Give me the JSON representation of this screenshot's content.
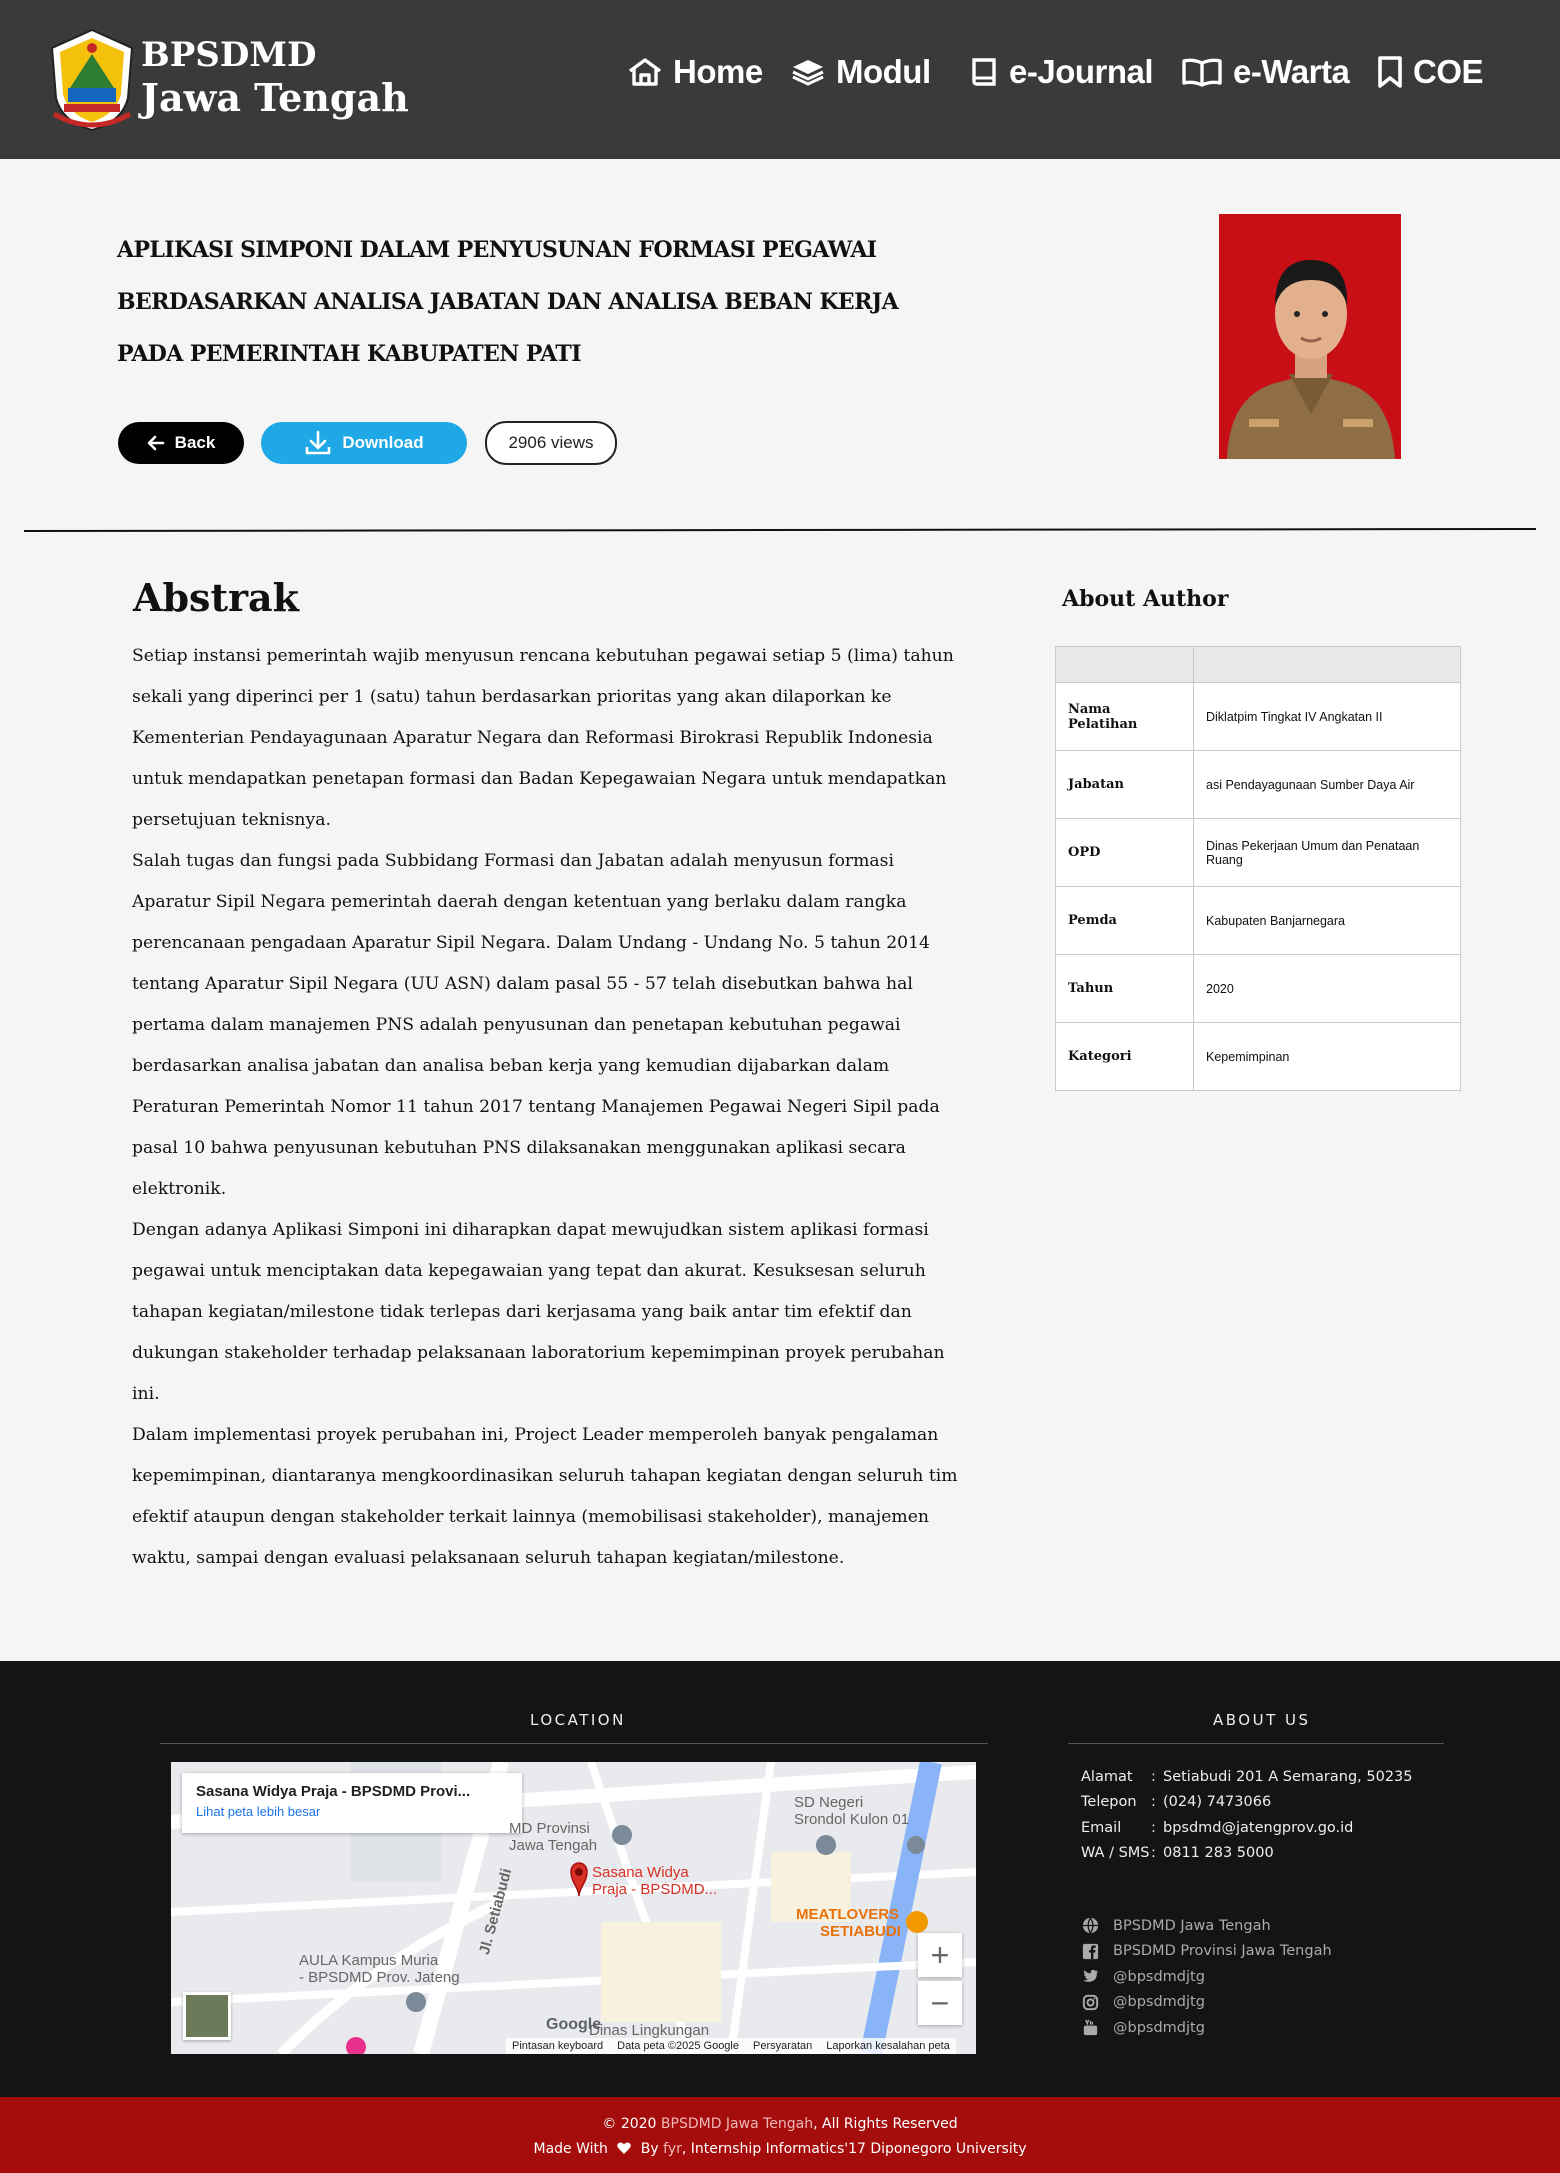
{
  "brand": {
    "line1": "BPSDMD",
    "line2": "Jawa Tengah"
  },
  "nav": [
    {
      "label": "Home",
      "icon": "home-icon"
    },
    {
      "label": "Modul",
      "icon": "layers-icon"
    },
    {
      "label": "e-Journal",
      "icon": "book-icon"
    },
    {
      "label": "e-Warta",
      "icon": "open-book-icon"
    },
    {
      "label": "COE",
      "icon": "bookmark-icon"
    }
  ],
  "article": {
    "title_lines": [
      "APLIKASI SIMPONI DALAM PENYUSUNAN FORMASI PEGAWAI",
      "BERDASARKAN ANALISA JABATAN DAN ANALISA BEBAN KERJA",
      "PADA PEMERINTAH KABUPATEN PATI"
    ],
    "back_label": "Back",
    "download_label": "Download",
    "views_label": "2906 views"
  },
  "abstract": {
    "heading": "Abstrak",
    "paragraphs": [
      "Setiap instansi pemerintah wajib menyusun rencana kebutuhan pegawai setiap 5 (lima) tahun sekali yang diperinci per 1 (satu) tahun berdasarkan prioritas yang akan dilaporkan ke Kementerian Pendayagunaan Aparatur Negara dan Reformasi Birokrasi Republik Indonesia untuk mendapatkan penetapan formasi dan Badan Kepegawaian Negara untuk mendapatkan persetujuan teknisnya.",
      "Salah tugas dan fungsi pada Subbidang Formasi dan Jabatan adalah menyusun formasi Aparatur Sipil Negara pemerintah daerah dengan ketentuan yang berlaku dalam rangka perencanaan pengadaan Aparatur Sipil Negara. Dalam Undang - Undang No. 5 tahun 2014 tentang Aparatur Sipil Negara (UU ASN) dalam pasal 55 - 57 telah disebutkan bahwa hal pertama dalam manajemen PNS adalah penyusunan dan penetapan kebutuhan pegawai berdasarkan analisa jabatan dan analisa beban kerja yang kemudian dijabarkan dalam Peraturan Pemerintah Nomor 11 tahun 2017 tentang Manajemen Pegawai Negeri Sipil pada pasal 10 bahwa penyusunan kebutuhan PNS dilaksanakan menggunakan aplikasi secara elektronik.",
      "Dengan adanya Aplikasi Simponi ini diharapkan dapat mewujudkan sistem aplikasi formasi pegawai untuk menciptakan data kepegawaian yang tepat dan akurat. Kesuksesan seluruh tahapan kegiatan/milestone tidak terlepas dari kerjasama yang baik antar tim efektif dan dukungan stakeholder terhadap pelaksanaan laboratorium kepemimpinan proyek perubahan ini.",
      "Dalam implementasi proyek perubahan ini, Project Leader memperoleh banyak pengalaman kepemimpinan, diantaranya mengkoordinasikan seluruh tahapan kegiatan dengan seluruh tim efektif ataupun dengan stakeholder terkait lainnya (memobilisasi stakeholder), manajemen waktu, sampai dengan evaluasi pelaksanaan seluruh tahapan kegiatan/milestone."
    ]
  },
  "author": {
    "heading": "About Author",
    "rows": [
      {
        "key": "Nama Pelatihan",
        "value": "Diklatpim Tingkat IV Angkatan II"
      },
      {
        "key": "Jabatan",
        "value": "asi Pendayagunaan Sumber Daya Air"
      },
      {
        "key": "OPD",
        "value": "Dinas Pekerjaan Umum dan Penataan Ruang"
      },
      {
        "key": "Pemda",
        "value": "Kabupaten Banjarnegara"
      },
      {
        "key": "Tahun",
        "value": "2020"
      },
      {
        "key": "Kategori",
        "value": "Kepemimpinan"
      }
    ]
  },
  "footer": {
    "location_heading": "LOCATION",
    "about_heading": "ABOUT US",
    "map": {
      "place_title": "Sasana Widya Praja - BPSDMD Provi...",
      "larger_map_link": "Lihat peta lebih besar",
      "labels": [
        "Sasana Widya",
        "Praja - BPSDMD...",
        "SD Negeri",
        "Srondol Kulon 01",
        "MD Provinsi",
        "Jawa Tengah",
        "MEATLOVERS",
        "SETIABUDI",
        "AULA Kampus Muria",
        "- BPSDMD Prov. Jateng",
        "Jl. Setiabudi",
        "Dinas Lingkungan",
        "Google"
      ],
      "footer_links": [
        "Pintasan keyboard",
        "Data peta ©2025 Google",
        "Persyaratan",
        "Laporkan kesalahan peta"
      ],
      "zoom_in": "+",
      "zoom_out": "−"
    },
    "contact": [
      {
        "label": "Alamat",
        "value": "Setiabudi 201 A Semarang, 50235"
      },
      {
        "label": "Telepon",
        "value": "(024) 7473066"
      },
      {
        "label": "Email",
        "value": "bpsdmd@jatengprov.go.id"
      },
      {
        "label": "WA / SMS",
        "value": "0811 283 5000"
      }
    ],
    "social": [
      {
        "icon": "globe-icon",
        "text": "BPSDMD Jawa Tengah"
      },
      {
        "icon": "facebook-icon",
        "text": "BPSDMD Provinsi Jawa Tengah"
      },
      {
        "icon": "twitter-icon",
        "text": "@bpsdmdjtg"
      },
      {
        "icon": "instagram-icon",
        "text": "@bpsdmdjtg"
      },
      {
        "icon": "youtube-icon",
        "text": "@bpsdmdjtg"
      }
    ]
  },
  "copyright": {
    "prefix": "© 2020 ",
    "link": "BPSDMD Jawa Tengah",
    "suffix": ", All Rights Reserved",
    "made_with": "Made With",
    "by": "By",
    "author_link": "fyr",
    "credit": ", Internship Informatics'17 Diponegoro University"
  },
  "colors": {
    "header_bg": "#3b3a3a",
    "download_blue": "#1ea8e6",
    "footer_bg": "#141414",
    "bottom_bar_red": "#a50c0c",
    "photo_bg_red": "#c80f16"
  }
}
